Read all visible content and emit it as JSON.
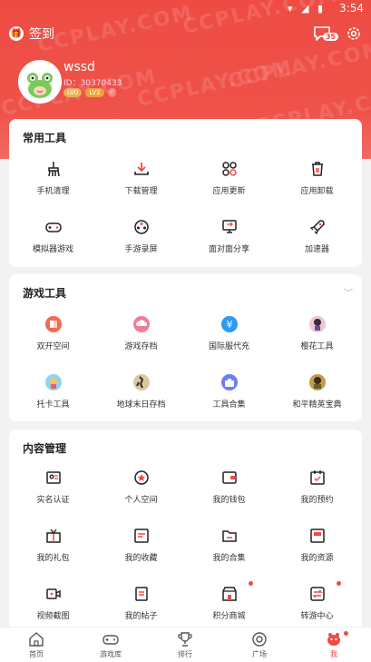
{
  "status": {
    "time": "3:54"
  },
  "header": {
    "signin_label": "签到",
    "message_badge": "35",
    "username": "wssd",
    "user_id": "ID：30370433",
    "vip_level": "LV0",
    "level": "LV2",
    "watermark": "CCPLAY.COM"
  },
  "common_tools": {
    "title": "常用工具",
    "items": [
      {
        "label": "手机清理",
        "icon": "broom-icon"
      },
      {
        "label": "下载管理",
        "icon": "download-icon"
      },
      {
        "label": "应用更新",
        "icon": "apps-update-icon"
      },
      {
        "label": "应用卸载",
        "icon": "trash-icon"
      },
      {
        "label": "模拟器游戏",
        "icon": "gamepad-icon"
      },
      {
        "label": "手游录屏",
        "icon": "film-reel-icon"
      },
      {
        "label": "面对面分享",
        "icon": "share-screen-icon"
      },
      {
        "label": "加速器",
        "icon": "rocket-icon"
      }
    ]
  },
  "game_tools": {
    "title": "游戏工具",
    "items": [
      {
        "label": "双开空间",
        "icon": "dual-space-icon"
      },
      {
        "label": "游戏存档",
        "icon": "cloud-save-icon"
      },
      {
        "label": "国际服代充",
        "icon": "yen-icon"
      },
      {
        "label": "樱花工具",
        "icon": "sakura-tool-icon"
      },
      {
        "label": "托卡工具",
        "icon": "toca-tool-icon"
      },
      {
        "label": "地球末日存档",
        "icon": "last-day-earth-icon"
      },
      {
        "label": "工具合集",
        "icon": "toolbox-icon"
      },
      {
        "label": "和平精英宝典",
        "icon": "pubg-guide-icon"
      }
    ]
  },
  "content_mgmt": {
    "title": "内容管理",
    "items": [
      {
        "label": "实名认证",
        "icon": "id-card-icon"
      },
      {
        "label": "个人空间",
        "icon": "star-badge-icon"
      },
      {
        "label": "我的钱包",
        "icon": "wallet-icon"
      },
      {
        "label": "我的预约",
        "icon": "calendar-check-icon"
      },
      {
        "label": "我的礼包",
        "icon": "gift-box-icon"
      },
      {
        "label": "我的收藏",
        "icon": "favorites-icon"
      },
      {
        "label": "我的合集",
        "icon": "folder-icon"
      },
      {
        "label": "我的资源",
        "icon": "resource-icon"
      },
      {
        "label": "视频截图",
        "icon": "video-camera-icon"
      },
      {
        "label": "我的帖子",
        "icon": "post-icon"
      },
      {
        "label": "积分商城",
        "icon": "store-icon"
      },
      {
        "label": "转游中心",
        "icon": "transfer-icon"
      }
    ]
  },
  "tabbar": {
    "tabs": [
      {
        "label": "首页",
        "icon": "home-icon"
      },
      {
        "label": "游戏库",
        "icon": "game-library-icon"
      },
      {
        "label": "排行",
        "icon": "trophy-icon"
      },
      {
        "label": "广场",
        "icon": "square-icon"
      },
      {
        "label": "我",
        "icon": "me-icon"
      }
    ]
  },
  "colors": {
    "accent": "#ee4c43",
    "background": "#f2f2f2"
  }
}
